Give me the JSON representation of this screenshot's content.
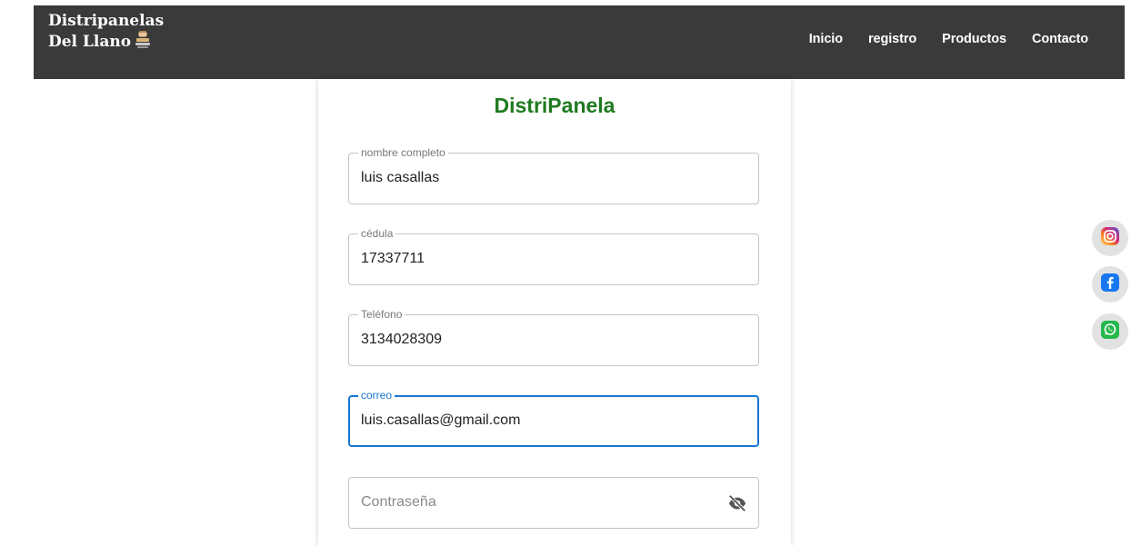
{
  "header": {
    "brand_line1": "Distripanelas",
    "brand_line2": "Del Llano",
    "nav": [
      {
        "label": "Inicio"
      },
      {
        "label": "registro"
      },
      {
        "label": "Productos"
      },
      {
        "label": "Contacto"
      }
    ]
  },
  "form": {
    "title": "DistriPanela",
    "fields": [
      {
        "label": "nombre completo",
        "value": "luis casallas"
      },
      {
        "label": "cédula",
        "value": "17337711"
      },
      {
        "label": "Teléfono",
        "value": "3134028309"
      },
      {
        "label": "correo",
        "value": "luis.casallas@gmail.com",
        "focused": true
      },
      {
        "placeholder": "Contraseña",
        "value": ""
      }
    ]
  },
  "social": [
    {
      "icon": "instagram-icon",
      "color": "#e1306c"
    },
    {
      "icon": "facebook-icon",
      "color": "#1877f2"
    },
    {
      "icon": "whatsapp-icon",
      "color": "#25d366"
    }
  ],
  "colors": {
    "navbar": "#3a3a3a",
    "title_green": "#1f7a1f",
    "focus_blue": "#1976d2"
  }
}
